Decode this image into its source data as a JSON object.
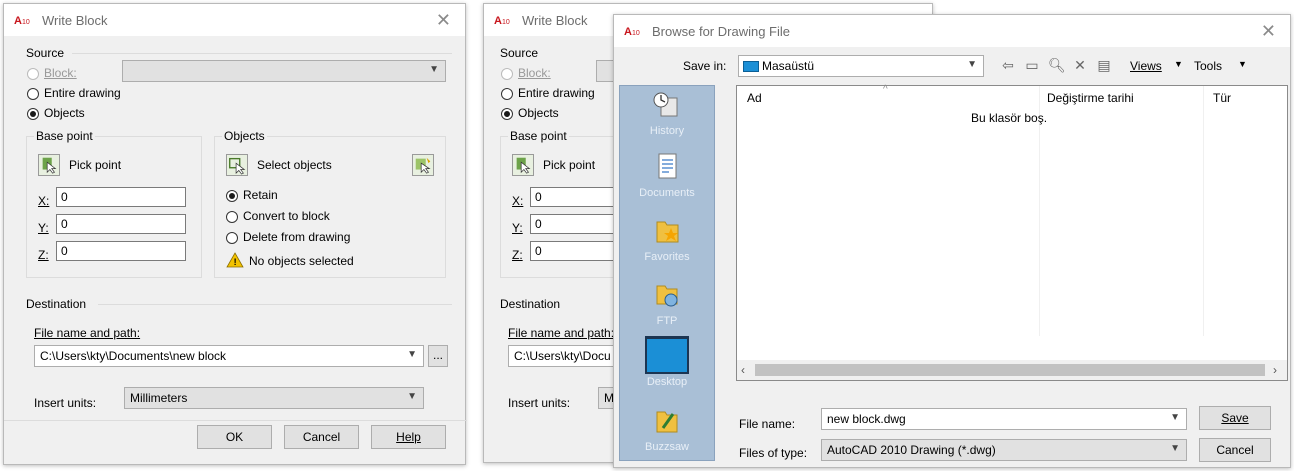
{
  "write_block": {
    "title": "Write Block",
    "source_label": "Source",
    "block_label": "Block:",
    "entire_drawing_label": "Entire drawing",
    "objects_label": "Objects",
    "base_point_label": "Base point",
    "pick_point_label": "Pick point",
    "x_label": "X:",
    "x_value": "0",
    "y_label": "Y:",
    "y_value": "0",
    "z_label": "Z:",
    "z_value": "0",
    "objects_group_label": "Objects",
    "select_objects_label": "Select objects",
    "retain_label": "Retain",
    "convert_label": "Convert to block",
    "delete_label": "Delete from drawing",
    "warning_text": "No objects selected",
    "destination_label": "Destination",
    "file_name_path_label": "File name and path:",
    "file_path_value": "C:\\Users\\kty\\Documents\\new block",
    "browse_label": "...",
    "insert_units_label": "Insert units:",
    "insert_units_value": "Millimeters",
    "ok_label": "OK",
    "cancel_label": "Cancel",
    "help_label": "Help"
  },
  "write_block_2": {
    "file_path_value": "C:\\Users\\kty\\Docu",
    "insert_units_value": "M"
  },
  "browse": {
    "title": "Browse for Drawing File",
    "save_in_label": "Save in:",
    "save_in_value": "Masaüstü",
    "views_label": "Views",
    "tools_label": "Tools",
    "places": [
      "History",
      "Documents",
      "Favorites",
      "FTP",
      "Desktop",
      "Buzzsaw"
    ],
    "columns": [
      "Ad",
      "Değiştirme tarihi",
      "Tür"
    ],
    "empty_text": "Bu klasör boş.",
    "file_name_label": "File name:",
    "file_name_value": "new block.dwg",
    "files_of_type_label": "Files of type:",
    "files_of_type_value": "AutoCAD 2010 Drawing (*.dwg)",
    "save_label": "Save",
    "cancel_label": "Cancel"
  }
}
